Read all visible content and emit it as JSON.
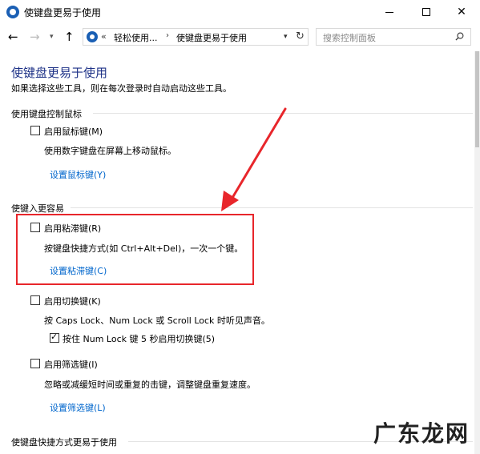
{
  "window": {
    "title": "使键盘更易于使用",
    "minimize_label": "—",
    "maximize_label": "",
    "close_label": "✕"
  },
  "nav": {
    "back": "←",
    "forward": "→",
    "history": "▾",
    "up": "↑",
    "breadcrumb_prefix": "«",
    "breadcrumb_1": "轻松使用...",
    "breadcrumb_sep": "›",
    "breadcrumb_2": "使键盘更易于使用",
    "dropdown": "▾",
    "refresh": "↻",
    "search_placeholder": "搜索控制面板"
  },
  "page": {
    "title": "使键盘更易于使用",
    "description": "如果选择这些工具，则在每次登录时自动启动这些工具。"
  },
  "sections": {
    "mouse": {
      "title": "使用键盘控制鼠标",
      "checkbox_label": "启用鼠标键(M)",
      "checked": false,
      "description": "使用数字键盘在屏幕上移动鼠标。",
      "link": "设置鼠标键(Y)"
    },
    "typing": {
      "title": "使键入更容易",
      "sticky": {
        "checkbox_label": "启用粘滞键(R)",
        "checked": false,
        "description": "按键盘快捷方式(如 Ctrl+Alt+Del)，一次一个键。",
        "link": "设置粘滞键(C)"
      },
      "toggle": {
        "checkbox_label": "启用切换键(K)",
        "checked": false,
        "description": "按 Caps Lock、Num Lock 或 Scroll Lock 时听见声音。",
        "sub_checkbox_label": "按住 Num Lock 键 5 秒启用切换键(5)",
        "sub_checked": true
      },
      "filter": {
        "checkbox_label": "启用筛选键(I)",
        "checked": false,
        "description": "忽略或减缓短时间或重复的击键，调整键盘重复速度。",
        "link": "设置筛选键(L)"
      }
    },
    "shortcuts": {
      "title": "使键盘快捷方式更易于使用"
    }
  },
  "annotation": {
    "color": "#e8262b"
  },
  "watermark": "广东龙网"
}
